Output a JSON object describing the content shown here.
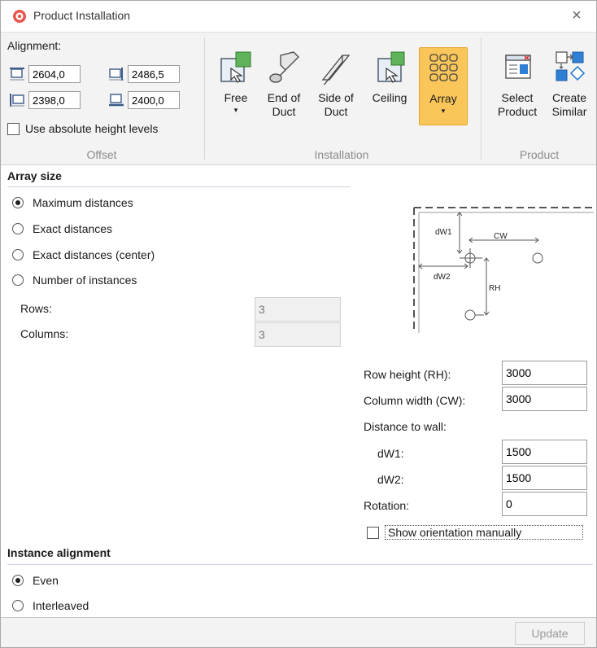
{
  "window": {
    "title": "Product Installation",
    "close_glyph": "×",
    "app_icon": "app-logo-icon"
  },
  "ribbon": {
    "offset": {
      "alignment_label": "Alignment:",
      "values": [
        "2604,0",
        "2486,5",
        "2398,0",
        "2400,0"
      ],
      "use_absolute_label": "Use absolute height levels",
      "use_absolute_checked": false,
      "group_label": "Offset"
    },
    "installation": {
      "buttons": [
        {
          "line1": "Free",
          "line2": "",
          "has_caret": true,
          "icon": "free-install-icon",
          "active": false
        },
        {
          "line1": "End of",
          "line2": "Duct",
          "has_caret": false,
          "icon": "end-of-duct-icon",
          "active": false
        },
        {
          "line1": "Side of",
          "line2": "Duct",
          "has_caret": false,
          "icon": "side-of-duct-icon",
          "active": false
        },
        {
          "line1": "Ceiling",
          "line2": "",
          "has_caret": false,
          "icon": "ceiling-install-icon",
          "active": false
        },
        {
          "line1": "Array",
          "line2": "",
          "has_caret": true,
          "icon": "array-grid-icon",
          "active": true
        }
      ],
      "group_label": "Installation"
    },
    "product": {
      "buttons": [
        {
          "line1": "Select",
          "line2": "Product",
          "icon": "select-product-icon"
        },
        {
          "line1": "Create",
          "line2": "Similar",
          "icon": "create-similar-icon"
        }
      ],
      "group_label": "Product"
    },
    "caret_glyph": "▾"
  },
  "array_size": {
    "heading": "Array size",
    "options": [
      "Maximum distances",
      "Exact distances",
      "Exact distances (center)",
      "Number of instances"
    ],
    "selected_index": 0,
    "rows_label": "Rows:",
    "rows_value": "3",
    "columns_label": "Columns:",
    "columns_value": "3"
  },
  "diagram": {
    "label_dw1": "dW1",
    "label_cw": "CW",
    "label_dw2": "dW2",
    "label_rh": "RH"
  },
  "params": {
    "row_height_label": "Row height (RH):",
    "row_height_value": "3000",
    "column_width_label": "Column width (CW):",
    "column_width_value": "3000",
    "distance_label": "Distance to wall:",
    "dw1_label": "dW1:",
    "dw1_value": "1500",
    "dw2_label": "dW2:",
    "dw2_value": "1500",
    "rotation_label": "Rotation:",
    "rotation_value": "0",
    "show_orientation_label": "Show orientation manually",
    "show_orientation_checked": false
  },
  "instance_alignment": {
    "heading": "Instance alignment",
    "options": [
      "Even",
      "Interleaved"
    ],
    "selected_index": 0
  },
  "footer": {
    "update_label": "Update"
  }
}
